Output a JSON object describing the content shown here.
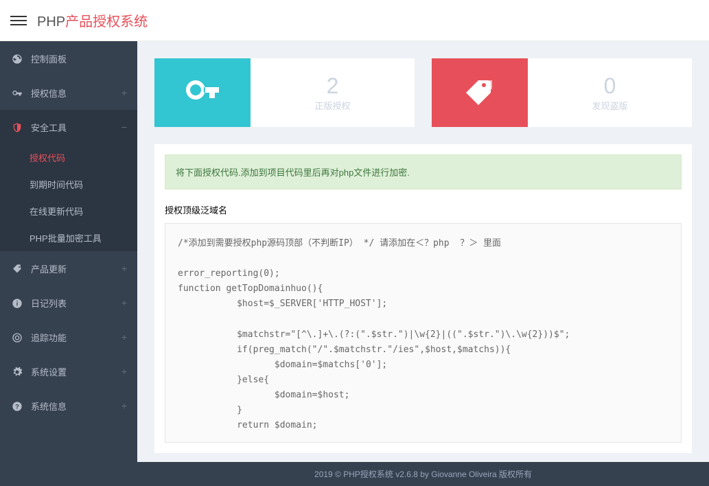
{
  "brand": {
    "prefix": "PHP",
    "suffix": "产品授权系统"
  },
  "sidebar": {
    "items": [
      {
        "label": "控制面板"
      },
      {
        "label": "授权信息"
      },
      {
        "label": "安全工具"
      },
      {
        "label": "产品更新"
      },
      {
        "label": "日记列表"
      },
      {
        "label": "追踪功能"
      },
      {
        "label": "系统设置"
      },
      {
        "label": "系统信息"
      }
    ],
    "submenu": [
      {
        "label": "授权代码"
      },
      {
        "label": "到期时间代码"
      },
      {
        "label": "在线更新代码"
      },
      {
        "label": "PHP批量加密工具"
      }
    ]
  },
  "stats": [
    {
      "value": "2",
      "label": "正版授权"
    },
    {
      "value": "0",
      "label": "发现盗版"
    }
  ],
  "alert": "将下面授权代码.添加到项目代码里后再对php文件进行加密.",
  "section_title": "授权顶级泛域名",
  "code": "/*添加到需要授权php源码顶部（不判断IP） */ 请添加在＜？php  ？＞ 里面\n\nerror_reporting(0);\nfunction getTopDomainhuo(){\n           $host=$_SERVER['HTTP_HOST'];\n\n           $matchstr=\"[^\\.]+\\.(?:(\".$str.\")|\\w{2}|((\".$str.\")\\.\\w{2}))$\";\n           if(preg_match(\"/\".$matchstr.\"/ies\",$host,$matchs)){\n                  $domain=$matchs['0'];\n           }else{\n                  $domain=$host;\n           }\n           return $domain;\n\n}",
  "footer": "2019 © PHP授权系统 v2.6.8 by Giovanne Oliveira 版权所有"
}
